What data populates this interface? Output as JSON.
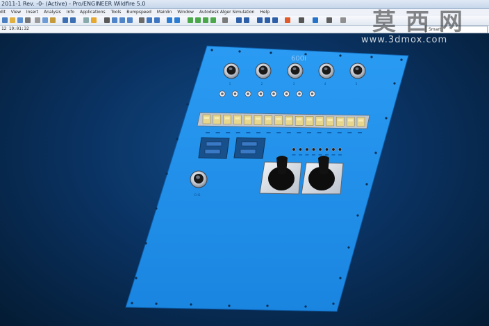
{
  "window": {
    "title": "2011-1 Rev. -0-  (Active) - Pro/ENGINEER Wildfire 5.0"
  },
  "menu": {
    "items": [
      "dit",
      "View",
      "Insert",
      "Analysis",
      "Info",
      "Applications",
      "Tools",
      "Bumpspeed",
      "Mainlin",
      "Window",
      "Autodesk Alger Simulation",
      "Help"
    ]
  },
  "toolbar": {
    "search_placeholder": "Smart"
  },
  "status": {
    "datetime": "12 19:01:32"
  },
  "panel": {
    "label_top": "600i",
    "knob_labels": [
      "1",
      "2",
      "3",
      "4",
      "5"
    ],
    "switch_count": 8,
    "led_count": 8,
    "terminal_count": 16,
    "bottom_left_label": "CH1"
  },
  "watermark": {
    "text_cn": "莫西网",
    "url": "www.3dmox.com"
  },
  "colors": {
    "panel": "#1e8fe8",
    "background": "#0a3363",
    "terminal": "#e7d78e"
  }
}
